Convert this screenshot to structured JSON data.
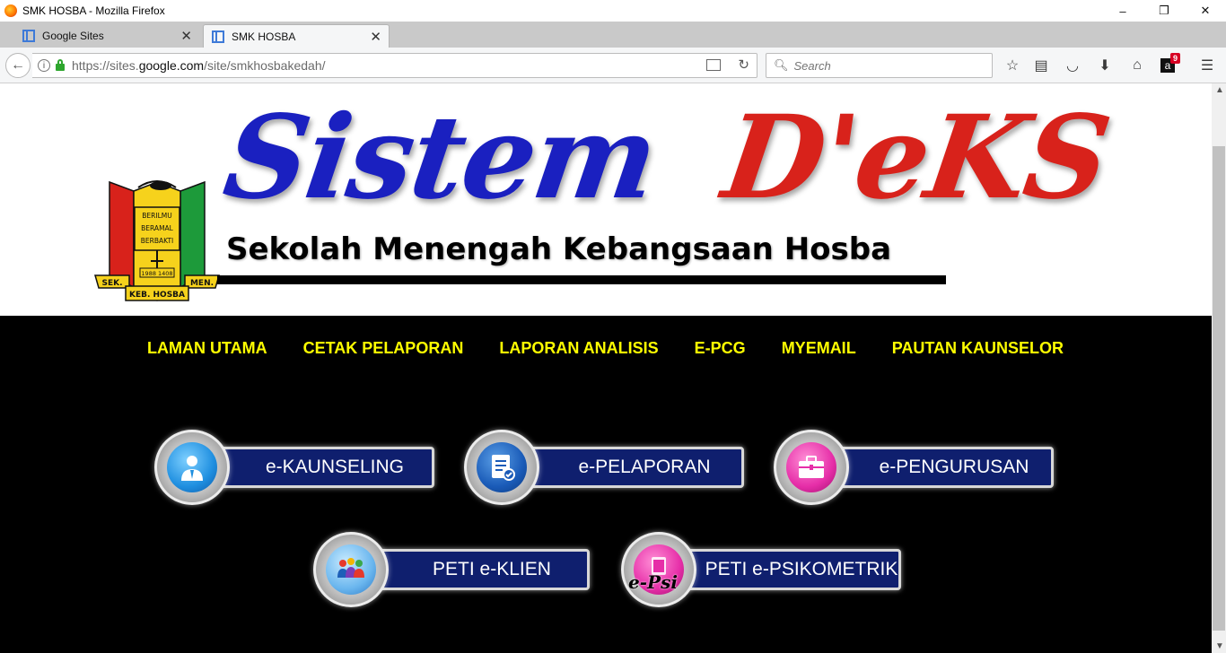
{
  "window": {
    "title": "SMK HOSBA - Mozilla Firefox",
    "controls": [
      "–",
      "❐",
      "✕"
    ]
  },
  "tabs": [
    {
      "label": "Google Sites",
      "active": false
    },
    {
      "label": "SMK HOSBA",
      "active": true
    }
  ],
  "navbar": {
    "url_prefix": "https://sites.",
    "url_domain": "google.com",
    "url_path": "/site/smkhosbakedah/",
    "search_placeholder": "Search",
    "notification_count": "9"
  },
  "banner": {
    "title_part1": "Sistem",
    "title_part2": "D'eKS",
    "subtitle": "Sekolah Menengah Kebangsaan Hosba",
    "crest_text": {
      "motto_line1": "BERILMU",
      "motto_line2": "BERAMAL",
      "motto_line3": "BERBAKTI",
      "year": "1988 1408",
      "left_ribbon": "SEK.",
      "right_ribbon": "MEN.",
      "bottom_ribbon": "KEB. HOSBA"
    }
  },
  "menu": [
    "LAMAN UTAMA",
    "CETAK PELAPORAN",
    "LAPORAN ANALISIS",
    "E-PCG",
    "MYEMAIL",
    "PAUTAN KAUNSELOR"
  ],
  "buttons": [
    {
      "label": "e-KAUNSELING",
      "icon": "counselor-icon",
      "color": "blue"
    },
    {
      "label": "e-PELAPORAN",
      "icon": "report-icon",
      "color": "darkblue"
    },
    {
      "label": "e-PENGURUSAN",
      "icon": "briefcase-icon",
      "color": "pink"
    },
    {
      "label": "PETI e-KLIEN",
      "icon": "clients-icon",
      "color": "lightblue"
    },
    {
      "label": "PETI e-PSIKOMETRIK",
      "icon": "epsi-icon",
      "color": "pink",
      "icon_text": "e-Psi"
    }
  ],
  "colors": {
    "title_blue": "#1a20c0",
    "title_red": "#d8221b",
    "menu_yellow": "#ffff00",
    "button_navy": "#0f1f6e"
  }
}
